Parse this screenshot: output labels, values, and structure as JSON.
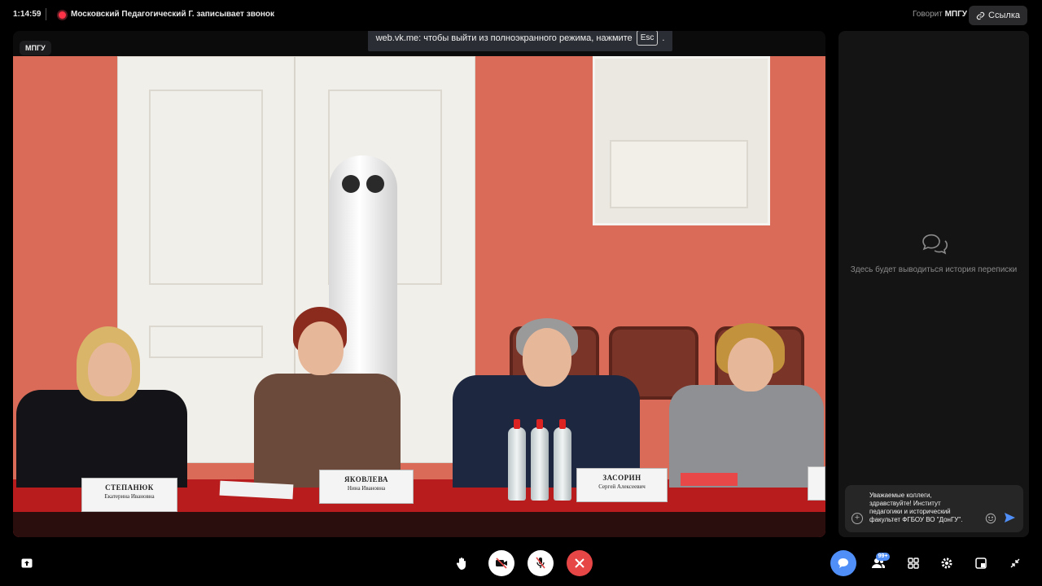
{
  "header": {
    "time": "1:14:59",
    "recording_text": "Московский Педагогический Г. записывает звонок",
    "speaking_label": "Говорит",
    "speaking_name": "МПГУ",
    "link_label": "Ссылка"
  },
  "video": {
    "participant_tag": "МПГУ",
    "fullscreen_notice": "web.vk.me: чтобы выйти из полноэкранного режима, нажмите",
    "esc_key": "Esc",
    "notice_end": ".",
    "nameplates": [
      {
        "surname": "СТЕПАНЮК",
        "given": "Екатерина Ивановна"
      },
      {
        "surname": "ЯКОВЛЕВА",
        "given": "Нина Ивановна"
      },
      {
        "surname": "ЗАСОРИН",
        "given": "Сергей Алексеевич"
      }
    ]
  },
  "chat": {
    "empty_text": "Здесь будет выводиться история переписки",
    "draft_message": "Уважаемые коллеги, здравствуйте! Институт педагогики  и исторический факультет ФГБОУ ВО \"ДонГУ\"."
  },
  "controls": {
    "participants_badge": "99+",
    "icons": [
      "upload-icon",
      "raise-hand-icon",
      "camera-off-icon",
      "mic-off-icon",
      "end-call-icon",
      "chat-icon",
      "participants-icon",
      "grid-icon",
      "settings-icon",
      "layout-icon",
      "exit-fullscreen-icon"
    ],
    "colors": {
      "end_call": "#e64646",
      "active": "#4f8ff7",
      "record": "#ff3347"
    }
  }
}
